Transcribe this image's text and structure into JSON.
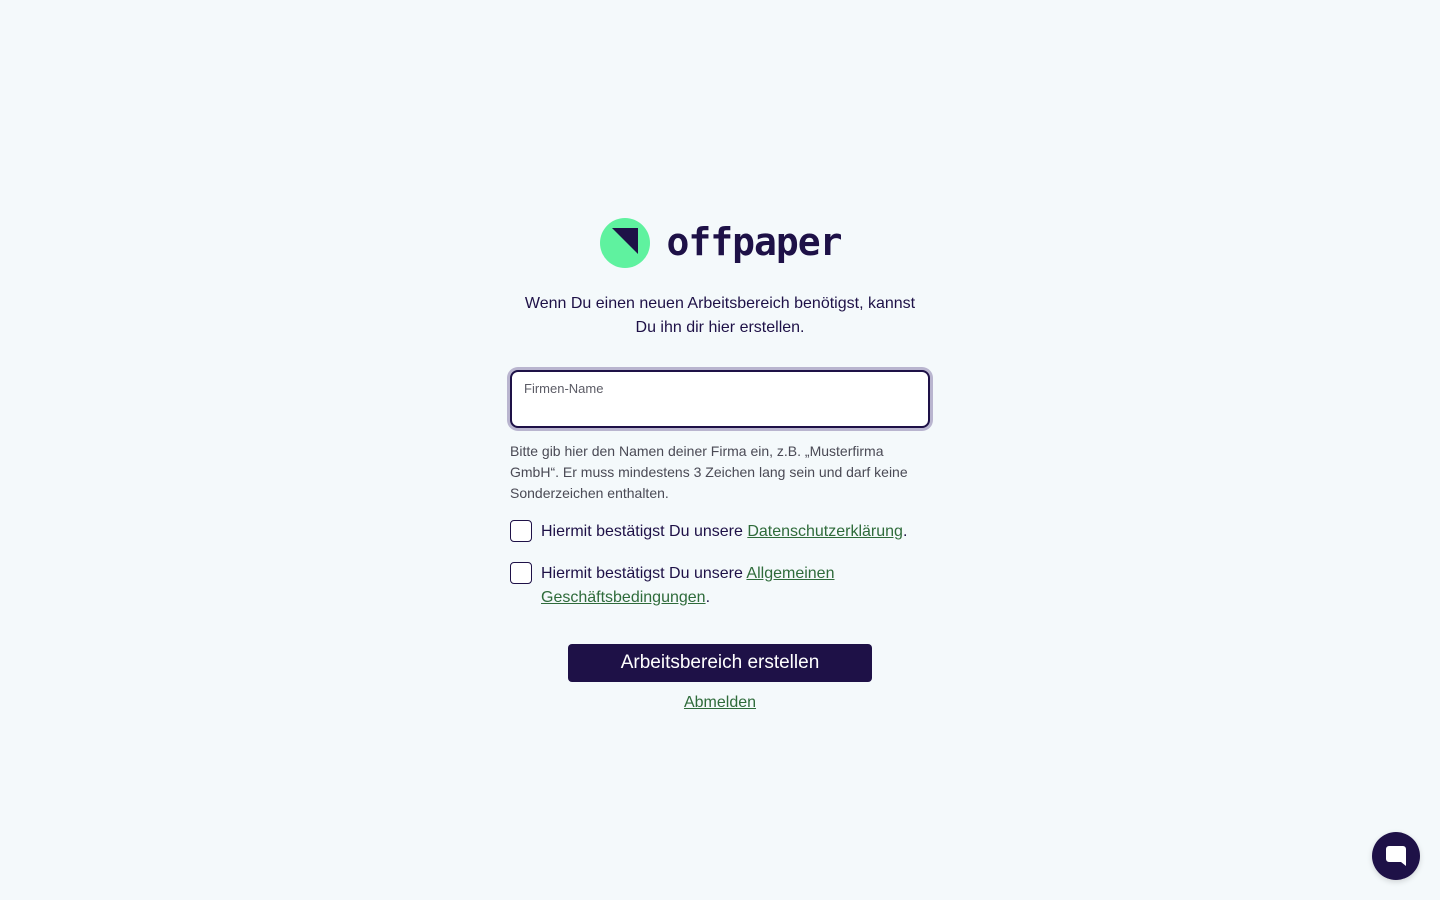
{
  "brand": {
    "name": "offpaper",
    "logo_icon": "offpaper-logo-icon",
    "logo_color": "#5ff29f",
    "text_color": "#1e1147"
  },
  "intro": "Wenn Du einen neuen Arbeitsbereich benötigst, kannst Du ihn dir hier erstellen.",
  "company_field": {
    "label": "Firmen-Name",
    "value": "",
    "hint": "Bitte gib hier den Namen deiner Firma ein, z.B. „Musterfirma GmbH“. Er muss mindestens 3 Zeichen lang sein und darf keine Sonderzeichen enthalten."
  },
  "privacy": {
    "prefix": "Hiermit bestätigst Du unsere ",
    "link": "Datenschutzerklärung",
    "suffix": ".",
    "checked": false
  },
  "terms": {
    "prefix": "Hiermit bestätigst Du unsere ",
    "link": "Allgemeinen Geschäftsbedingungen",
    "suffix": ".",
    "checked": false
  },
  "submit_label": "Arbeitsbereich erstellen",
  "logout_label": "Abmelden",
  "chat": {
    "icon": "chat-bubble-icon"
  },
  "colors": {
    "background": "#f4f9fb",
    "primary": "#1e1147",
    "link": "#2e6b3a",
    "accent": "#5ff29f"
  }
}
